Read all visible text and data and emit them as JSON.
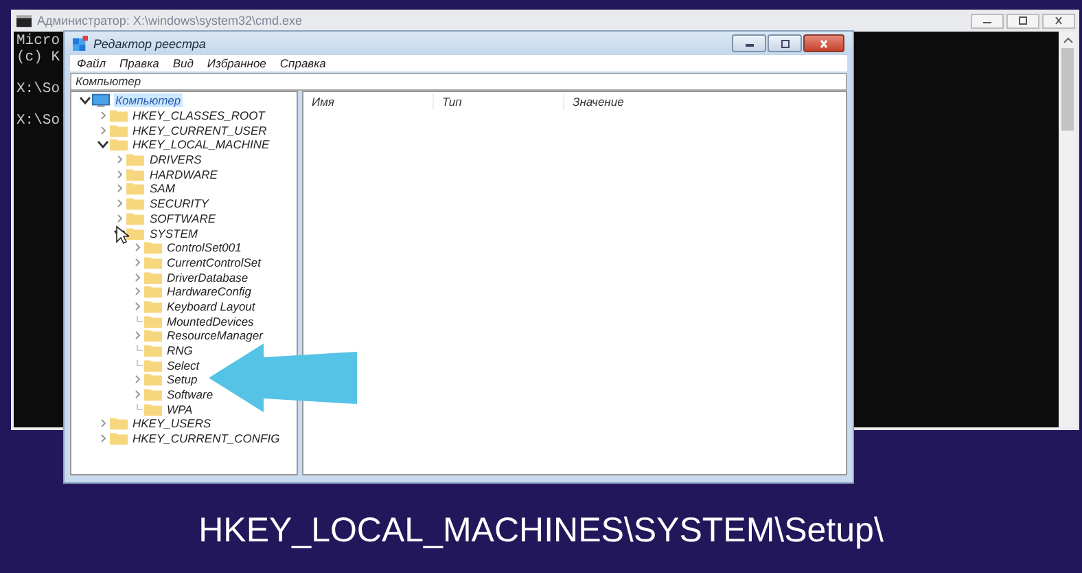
{
  "console_window": {
    "title": "Администратор: X:\\windows\\system32\\cmd.exe",
    "paragraphs": [
      [
        "Micro",
        "(c) K"
      ],
      [
        "X:\\So"
      ],
      [
        "X:\\So"
      ]
    ]
  },
  "regedit": {
    "title": "Редактор реестра",
    "menu": [
      "Файл",
      "Правка",
      "Вид",
      "Избранное",
      "Справка"
    ],
    "address": "Компьютер",
    "tree": [
      {
        "label": "Компьютер",
        "kind": "computer",
        "expandable": true,
        "expanded": true,
        "selected": true,
        "children": [
          {
            "label": "HKEY_CLASSES_ROOT",
            "expandable": true,
            "expanded": false,
            "selected": false
          },
          {
            "label": "HKEY_CURRENT_USER",
            "expandable": true,
            "expanded": false,
            "selected": false
          },
          {
            "label": "HKEY_LOCAL_MACHINE",
            "expandable": true,
            "expanded": true,
            "selected": false,
            "children": [
              {
                "label": "DRIVERS",
                "expandable": true,
                "expanded": false,
                "selected": false
              },
              {
                "label": "HARDWARE",
                "expandable": true,
                "expanded": false,
                "selected": false
              },
              {
                "label": "SAM",
                "expandable": true,
                "expanded": false,
                "selected": false
              },
              {
                "label": "SECURITY",
                "expandable": true,
                "expanded": false,
                "selected": false
              },
              {
                "label": "SOFTWARE",
                "expandable": true,
                "expanded": false,
                "selected": false
              },
              {
                "label": "SYSTEM",
                "expandable": true,
                "expanded": true,
                "selected": false,
                "children": [
                  {
                    "label": "ControlSet001",
                    "expandable": true,
                    "expanded": false,
                    "selected": false
                  },
                  {
                    "label": "CurrentControlSet",
                    "expandable": true,
                    "expanded": false,
                    "selected": false
                  },
                  {
                    "label": "DriverDatabase",
                    "expandable": true,
                    "expanded": false,
                    "selected": false
                  },
                  {
                    "label": "HardwareConfig",
                    "expandable": true,
                    "expanded": false,
                    "selected": false
                  },
                  {
                    "label": "Keyboard Layout",
                    "expandable": true,
                    "expanded": false,
                    "selected": false
                  },
                  {
                    "label": "MountedDevices",
                    "expandable": false,
                    "selected": false
                  },
                  {
                    "label": "ResourceManager",
                    "expandable": true,
                    "expanded": false,
                    "selected": false
                  },
                  {
                    "label": "RNG",
                    "expandable": false,
                    "selected": false
                  },
                  {
                    "label": "Select",
                    "expandable": false,
                    "selected": false
                  },
                  {
                    "label": "Setup",
                    "expandable": true,
                    "expanded": false,
                    "selected": false
                  },
                  {
                    "label": "Software",
                    "expandable": true,
                    "expanded": false,
                    "selected": false
                  },
                  {
                    "label": "WPA",
                    "expandable": false,
                    "selected": false
                  }
                ]
              }
            ]
          },
          {
            "label": "HKEY_USERS",
            "expandable": true,
            "expanded": false,
            "selected": false
          },
          {
            "label": "HKEY_CURRENT_CONFIG",
            "expandable": true,
            "expanded": false,
            "selected": false
          }
        ]
      }
    ],
    "columns": [
      "Имя",
      "Тип",
      "Значение"
    ]
  },
  "caption": "HKEY_LOCAL_MACHINES\\SYSTEM\\Setup\\"
}
